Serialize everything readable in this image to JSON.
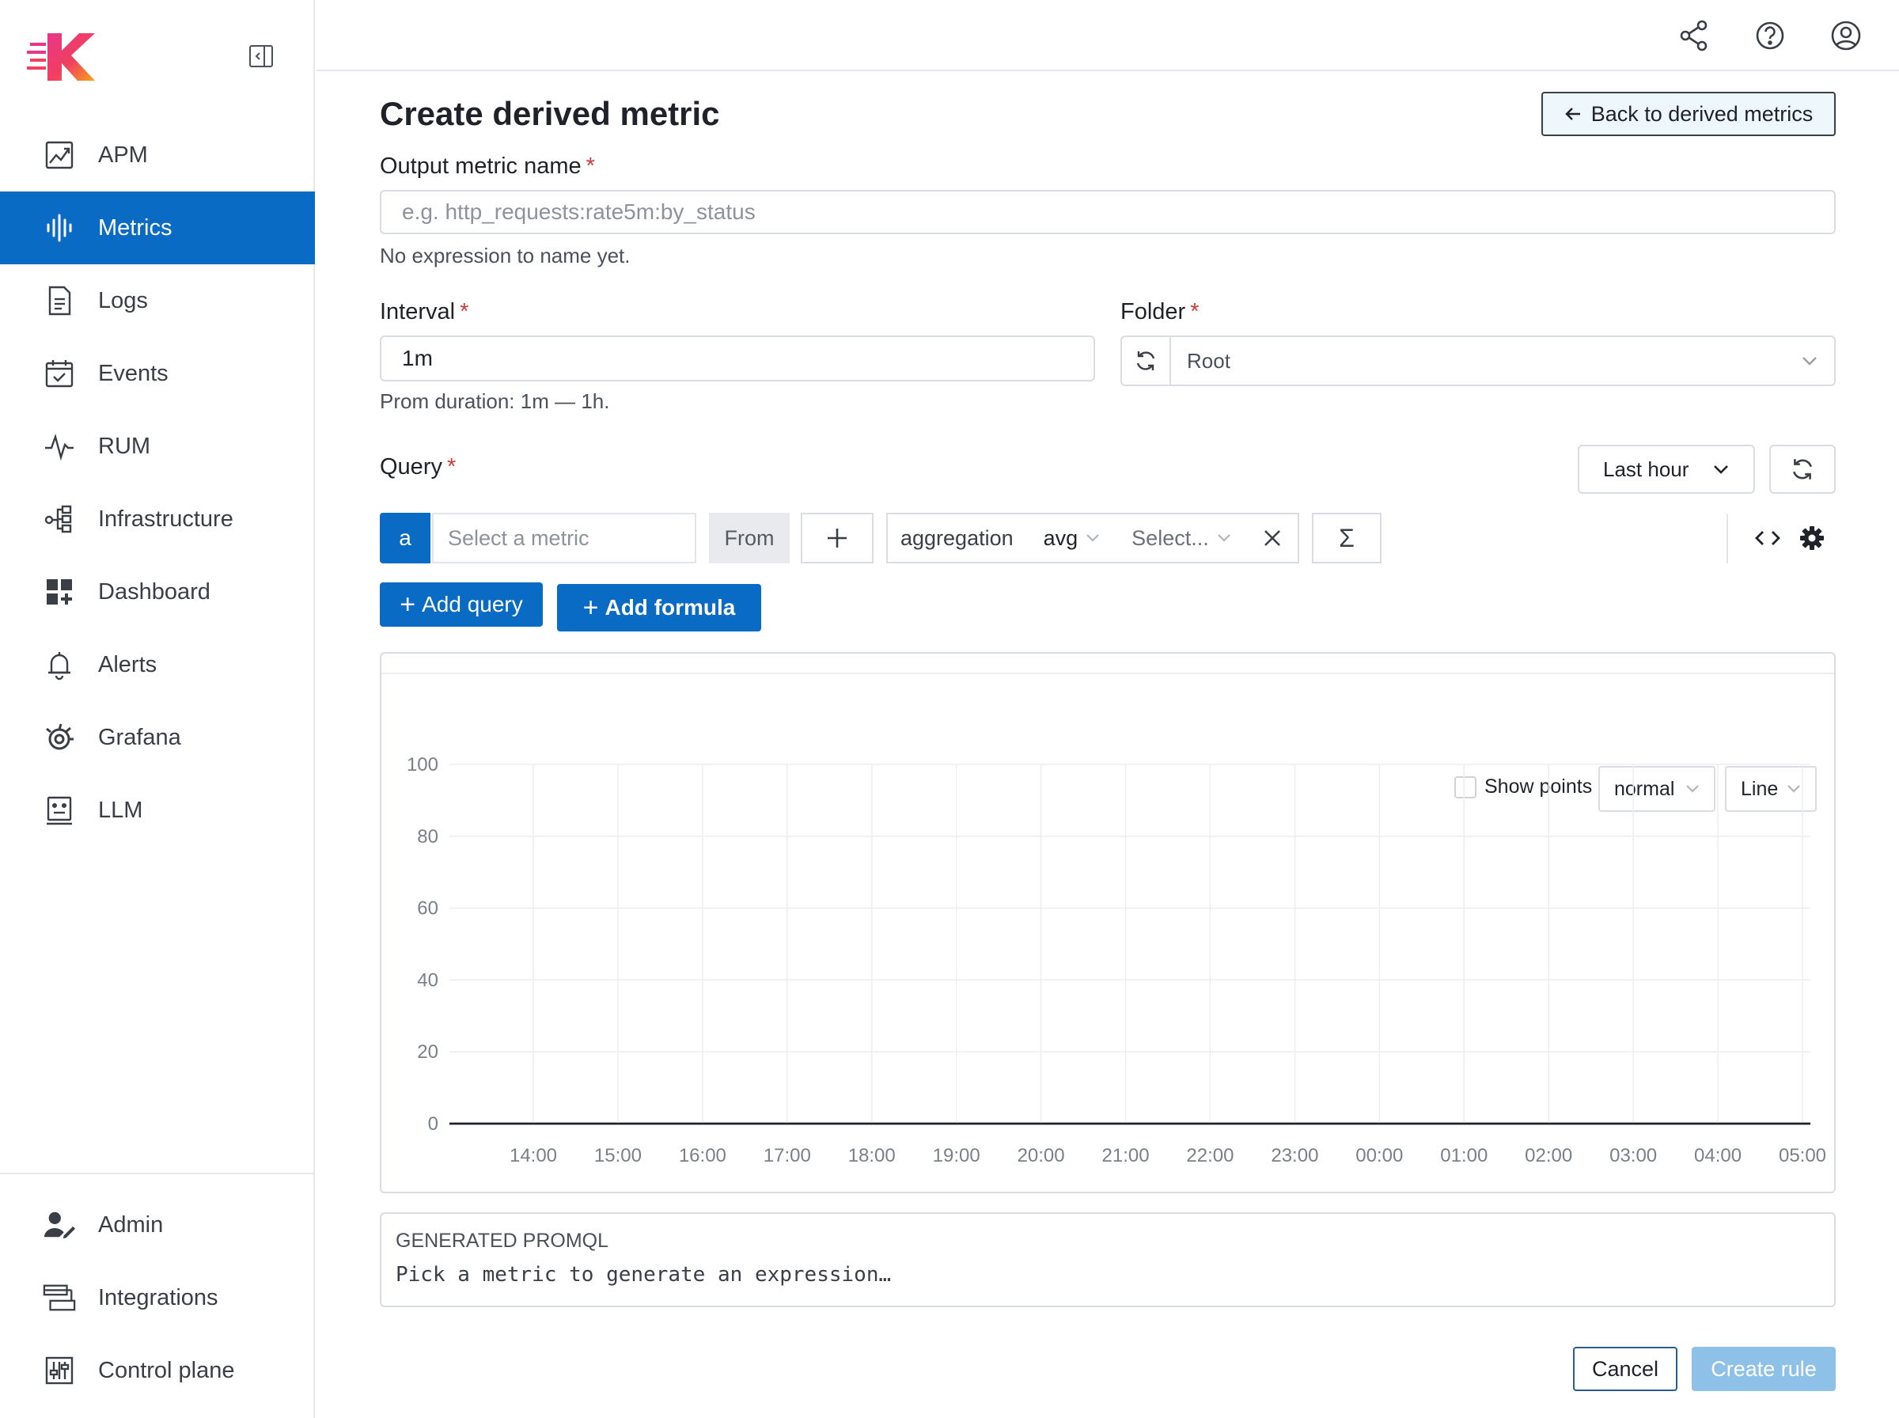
{
  "sidebar": {
    "logo_alt": "K",
    "items": [
      {
        "label": "APM",
        "icon": "apm-chart-icon"
      },
      {
        "label": "Metrics",
        "icon": "metrics-waveform-icon",
        "active": true
      },
      {
        "label": "Logs",
        "icon": "logs-document-icon"
      },
      {
        "label": "Events",
        "icon": "calendar-check-icon"
      },
      {
        "label": "RUM",
        "icon": "pulse-icon"
      },
      {
        "label": "Infrastructure",
        "icon": "infrastructure-nodes-icon"
      },
      {
        "label": "Dashboard",
        "icon": "dashboard-grid-icon"
      },
      {
        "label": "Alerts",
        "icon": "bell-icon"
      },
      {
        "label": "Grafana",
        "icon": "grafana-icon"
      },
      {
        "label": "LLM",
        "icon": "llm-robot-icon"
      }
    ],
    "bottom_items": [
      {
        "label": "Admin",
        "icon": "admin-user-icon"
      },
      {
        "label": "Integrations",
        "icon": "integrations-icon"
      },
      {
        "label": "Control plane",
        "icon": "control-plane-sliders-icon"
      }
    ]
  },
  "header": {
    "icons": [
      "share-icon",
      "help-icon",
      "account-icon"
    ]
  },
  "page": {
    "title": "Create derived metric",
    "back_button": "Back to derived metrics"
  },
  "form": {
    "output_name": {
      "label": "Output metric name",
      "required": "*",
      "placeholder": "e.g. http_requests:rate5m:by_status",
      "help": "No expression to name yet."
    },
    "interval": {
      "label": "Interval",
      "required": "*",
      "value": "1m",
      "help": "Prom duration: 1m — 1h."
    },
    "folder": {
      "label": "Folder",
      "required": "*",
      "value": "Root"
    },
    "query": {
      "label": "Query",
      "required": "*",
      "time_range": "Last hour",
      "letter": "a",
      "metric_placeholder": "Select a metric",
      "from_label": "From",
      "aggregation_label": "aggregation",
      "aggregation_value": "avg",
      "group_placeholder": "Select...",
      "sigma": "Σ"
    },
    "add_query": "Add query",
    "add_formula": "Add formula"
  },
  "chart": {
    "show_points_label": "Show points",
    "mode_select": "normal",
    "type_select": "Line"
  },
  "chart_data": {
    "type": "line",
    "x_ticks": [
      "14:00",
      "15:00",
      "16:00",
      "17:00",
      "18:00",
      "19:00",
      "20:00",
      "21:00",
      "22:00",
      "23:00",
      "00:00",
      "01:00",
      "02:00",
      "03:00",
      "04:00",
      "05:00"
    ],
    "y_ticks": [
      0,
      20,
      40,
      60,
      80,
      100
    ],
    "ylim": [
      0,
      100
    ],
    "series": [],
    "grid": true,
    "title": "",
    "xlabel": "",
    "ylabel": ""
  },
  "promql": {
    "title": "GENERATED PROMQL",
    "code": "Pick a metric to generate an expression…"
  },
  "footer": {
    "cancel": "Cancel",
    "create": "Create rule"
  },
  "colors": {
    "primary": "#0a6bc4",
    "required": "#d13b3b",
    "disabled_primary": "#8dc1e8"
  }
}
